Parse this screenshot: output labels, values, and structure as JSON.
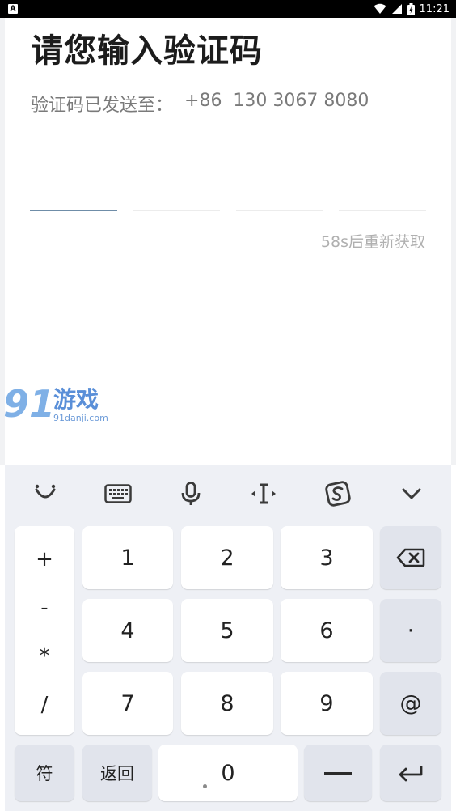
{
  "status_bar": {
    "app_indicator": "A",
    "time": "11:21"
  },
  "page": {
    "title": "请您输入验证码",
    "sent_to_label": "验证码已发送至：",
    "phone": "+86  130 3067 8080",
    "resend": "58s后重新获取"
  },
  "watermark": {
    "number": "91",
    "name": "游戏",
    "url": "91danji.com"
  },
  "keyboard": {
    "toolbar": [
      "smiley-icon",
      "keyboard-icon",
      "mic-icon",
      "cursor-icon",
      "sogou-icon",
      "chevron-down-icon"
    ],
    "symbols": [
      "+",
      "-",
      "*",
      "/"
    ],
    "digits": [
      "1",
      "2",
      "3",
      "4",
      "5",
      "6",
      "7",
      "8",
      "9",
      "0"
    ],
    "dot": "·",
    "at": "@",
    "fu": "符",
    "back": "返回"
  },
  "colors": {
    "active_underline": "#6f8da8",
    "keyboard_bg": "#eef0f5",
    "function_key": "#e1e4ec"
  }
}
